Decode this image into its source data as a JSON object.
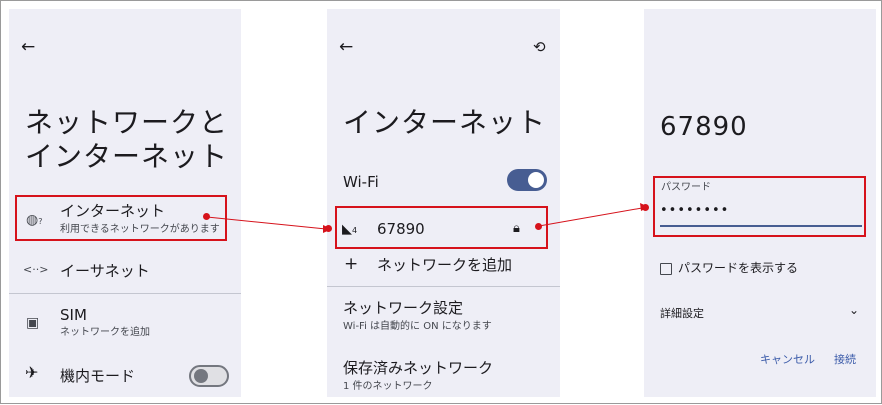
{
  "screen1": {
    "title_line1": "ネットワークと",
    "title_line2": "インターネット",
    "items": [
      {
        "label": "インターネット",
        "sub": "利用できるネットワークがあります",
        "icon": "globe-question-icon"
      },
      {
        "label": "イーサネット",
        "icon": "ethernet-icon"
      },
      {
        "label": "SIM",
        "sub": "ネットワークを追加",
        "icon": "sim-card-icon"
      },
      {
        "label": "機内モード",
        "icon": "airplane-icon",
        "toggle": "off"
      }
    ]
  },
  "screen2": {
    "title": "インターネット",
    "wifi_label": "Wi-Fi",
    "wifi_toggle": "on",
    "network_name": "67890",
    "add_network_label": "ネットワークを追加",
    "settings": {
      "label": "ネットワーク設定",
      "sub": "Wi-Fi は自動的に ON になります"
    },
    "saved": {
      "label": "保存済みネットワーク",
      "sub": "1 件のネットワーク"
    }
  },
  "screen3": {
    "title": "67890",
    "password_label": "パスワード",
    "password_value": "••••••••",
    "show_password_label": "パスワードを表示する",
    "advanced_label": "詳細設定",
    "cancel_label": "キャンセル",
    "connect_label": "接続"
  },
  "colors": {
    "highlight": "#d6121b",
    "accent": "#475d92",
    "background": "#eeeef6"
  }
}
